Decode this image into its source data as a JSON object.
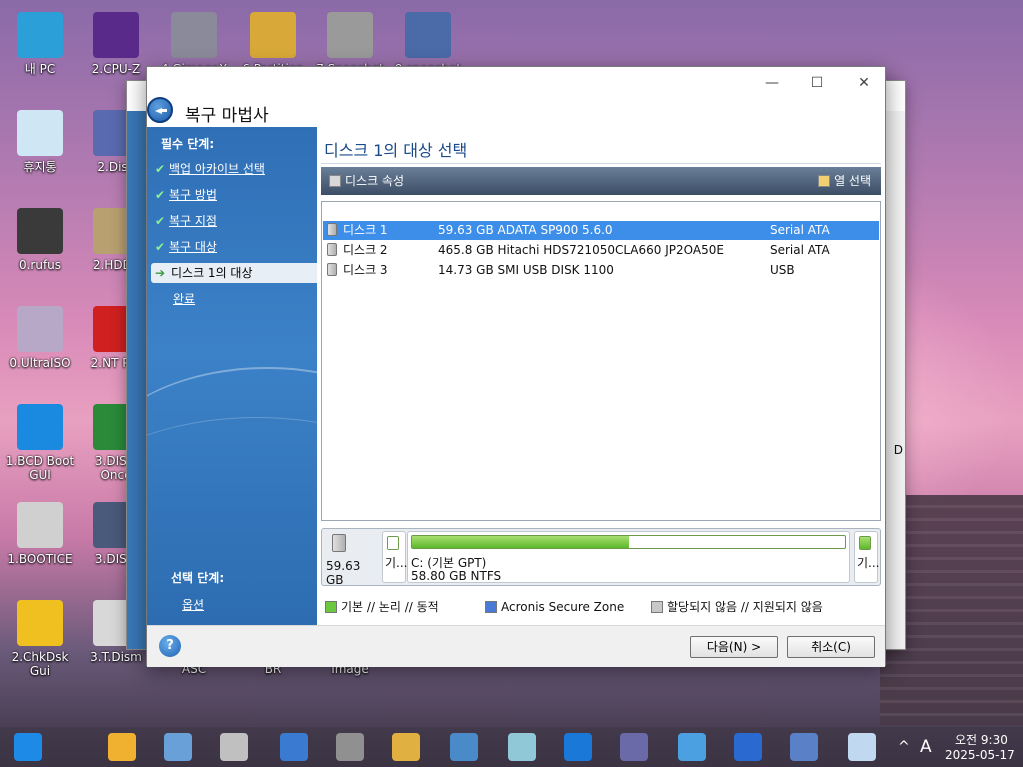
{
  "desktop": {
    "icons": [
      {
        "label": "내 PC",
        "color": "#2b9fd8"
      },
      {
        "label": "2.CPU-Z",
        "color": "#5a2a8a"
      },
      {
        "label": "4.GimageX",
        "color": "#8a8a9a"
      },
      {
        "label": "6.Partition",
        "color": "#d8a838"
      },
      {
        "label": "7.Snapshot",
        "color": "#9a9a9a"
      },
      {
        "label": "9.snapshot",
        "color": "#4a6aa8"
      },
      {
        "label": "휴지통",
        "color": "#cfe6f4"
      },
      {
        "label": "2.Disk",
        "color": "#5a6ab0"
      },
      {
        "label": "0.rufus",
        "color": "#3a3a3a"
      },
      {
        "label": "2.HDDT",
        "color": "#b8a070"
      },
      {
        "label": "0.UltraISO",
        "color": "#b8a8c8"
      },
      {
        "label": "2.NT PW",
        "color": "#d02020"
      },
      {
        "label": "1.BCD Boot GUI",
        "color": "#1a8ae0"
      },
      {
        "label": "3.DISM Once",
        "color": "#2a8a3a"
      },
      {
        "label": "1.BOOTICE",
        "color": "#d0d0d0"
      },
      {
        "label": "3.DISM",
        "color": "#4a5a7a"
      },
      {
        "label": "2.ChkDsk Gui",
        "color": "#f0c020"
      },
      {
        "label": "3.T.Dism",
        "color": "#d8d8d8"
      }
    ],
    "bottom_labels": [
      "ASC",
      "BR",
      "Image"
    ]
  },
  "dialog": {
    "title": "복구 마법사",
    "controls": {
      "minimize": "—",
      "maximize": "☐",
      "close": "✕"
    },
    "nav": {
      "required_heading": "필수 단계:",
      "steps": [
        {
          "label": "백업 아카이브 선택",
          "done": true
        },
        {
          "label": "복구 방법",
          "done": true
        },
        {
          "label": "복구 지점",
          "done": true
        },
        {
          "label": "복구 대상",
          "done": true
        },
        {
          "label": "디스크 1의 대상",
          "current": true
        },
        {
          "label": "완료"
        }
      ],
      "optional_heading": "선택 단계:",
      "optional_steps": [
        {
          "label": "옵션"
        }
      ]
    },
    "content": {
      "title": "디스크 1의 대상 선택",
      "toolbar": {
        "properties": "디스크 속성",
        "columns": "열 선택"
      },
      "disks": [
        {
          "name": "디스크 1",
          "desc": "59.63 GB ADATA SP900 5.6.0",
          "iface": "Serial ATA",
          "selected": true
        },
        {
          "name": "디스크 2",
          "desc": "465.8 GB Hitachi HDS721050CLA660 JP2OA50E",
          "iface": "Serial ATA"
        },
        {
          "name": "디스크 3",
          "desc": "14.73 GB SMI USB DISK 1100",
          "iface": "USB"
        }
      ],
      "map": {
        "disk_size": "59.63 GB",
        "left_partition": "기...",
        "main_partition_name": "C: (기본 GPT)",
        "main_partition_info": "58.80 GB  NTFS",
        "main_used_fraction": 0.5,
        "right_partition": "기..."
      },
      "legend": [
        {
          "label": "기본 // 논리 // 동적",
          "color": "#6cc83c"
        },
        {
          "label": "Acronis Secure Zone",
          "color": "#4a7ad8"
        },
        {
          "label": "할당되지 않음 // 지원되지 않음",
          "color": "#c8c8c8"
        }
      ]
    },
    "footer": {
      "help": "?",
      "next": "다음(N) >",
      "cancel": "취소(C)"
    }
  },
  "backwin": {
    "side_text": "D"
  },
  "taskbar": {
    "clock_time": "오전 9:30",
    "clock_date": "2025-05-17",
    "ime": "A",
    "chevron": "^"
  }
}
